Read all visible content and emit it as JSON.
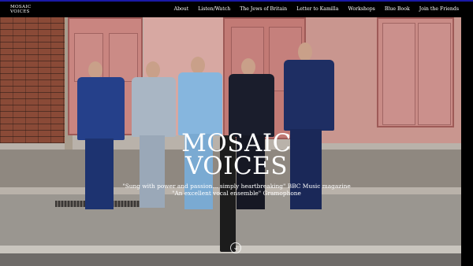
{
  "brand": {
    "line1": "MOSAIC",
    "line2": "VOICES"
  },
  "nav": {
    "items": [
      {
        "label": "About"
      },
      {
        "label": "Listen/Watch"
      },
      {
        "label": "The Jews of Britain"
      },
      {
        "label": "Letter to Kamilla"
      },
      {
        "label": "Workshops"
      },
      {
        "label": "Blue Book"
      },
      {
        "label": "Join the Friends"
      }
    ]
  },
  "hero": {
    "title_line1": "MOSAIC",
    "title_line2": "VOICES",
    "quote1": "\"Sung with power and passion... simply heartbreaking\" BBC Music magazine",
    "quote2": "\"An excellent vocal ensemble\" Gramophone"
  },
  "icons": {
    "scroll_down": "chevron-down-icon"
  },
  "colors": {
    "nav_background": "#000000",
    "top_accent": "#1a1aa6",
    "text": "#ffffff"
  }
}
